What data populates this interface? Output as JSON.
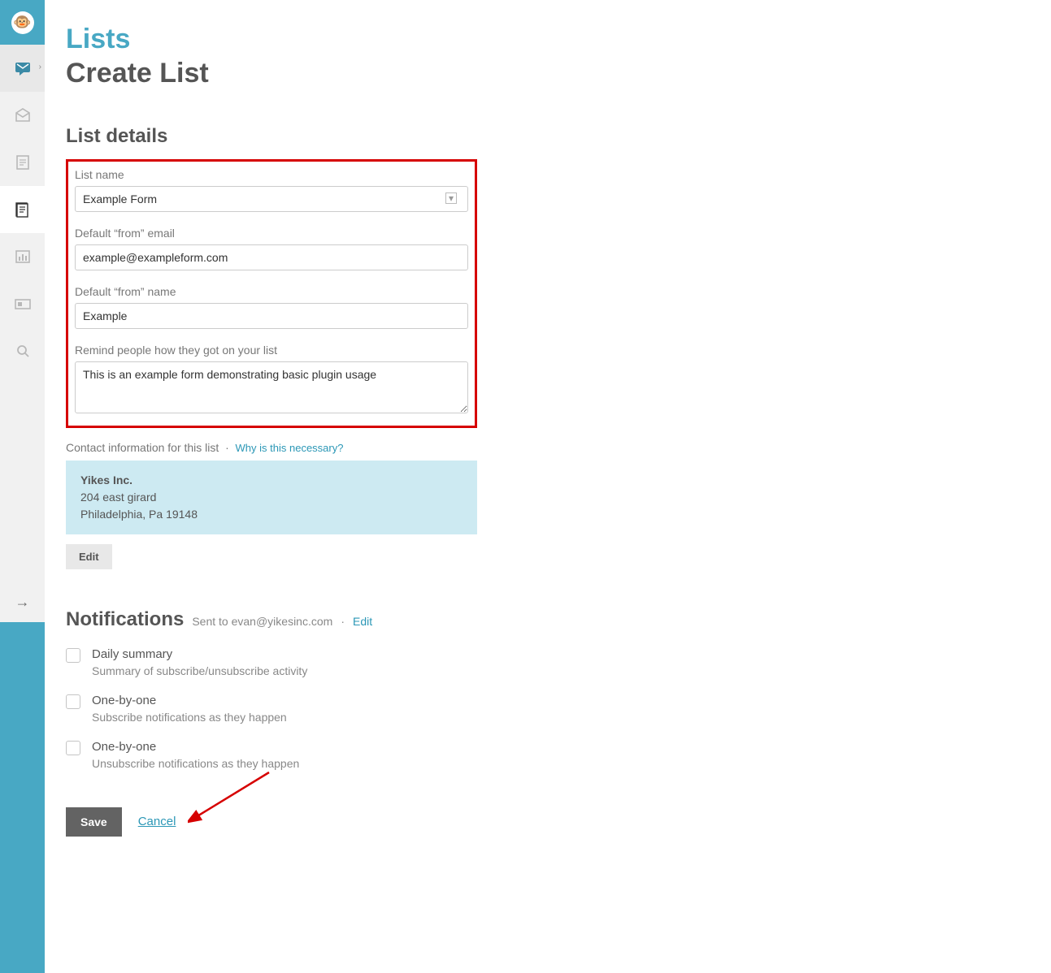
{
  "header": {
    "breadcrumb": "Lists",
    "title": "Create List"
  },
  "section_details": "List details",
  "form": {
    "list_name": {
      "label": "List name",
      "value": "Example Form"
    },
    "from_email": {
      "label": "Default “from” email",
      "value": "example@exampleform.com"
    },
    "from_name": {
      "label": "Default “from” name",
      "value": "Example"
    },
    "reminder": {
      "label": "Remind people how they got on your list",
      "value": "This is an example form demonstrating basic plugin usage"
    }
  },
  "contact": {
    "label_prefix": "Contact information for this list",
    "why_link": "Why is this necessary?",
    "company": "Yikes Inc.",
    "address1": "204 east girard",
    "address2": "Philadelphia, Pa 19148",
    "edit": "Edit"
  },
  "notifications": {
    "heading": "Notifications",
    "sent_to_label": "Sent to",
    "sent_to_email": "evan@yikesinc.com",
    "edit": "Edit",
    "items": [
      {
        "title": "Daily summary",
        "desc": "Summary of subscribe/unsubscribe activity"
      },
      {
        "title": "One-by-one",
        "desc": "Subscribe notifications as they happen"
      },
      {
        "title": "One-by-one",
        "desc": "Unsubscribe notifications as they happen"
      }
    ]
  },
  "actions": {
    "save": "Save",
    "cancel": "Cancel"
  }
}
